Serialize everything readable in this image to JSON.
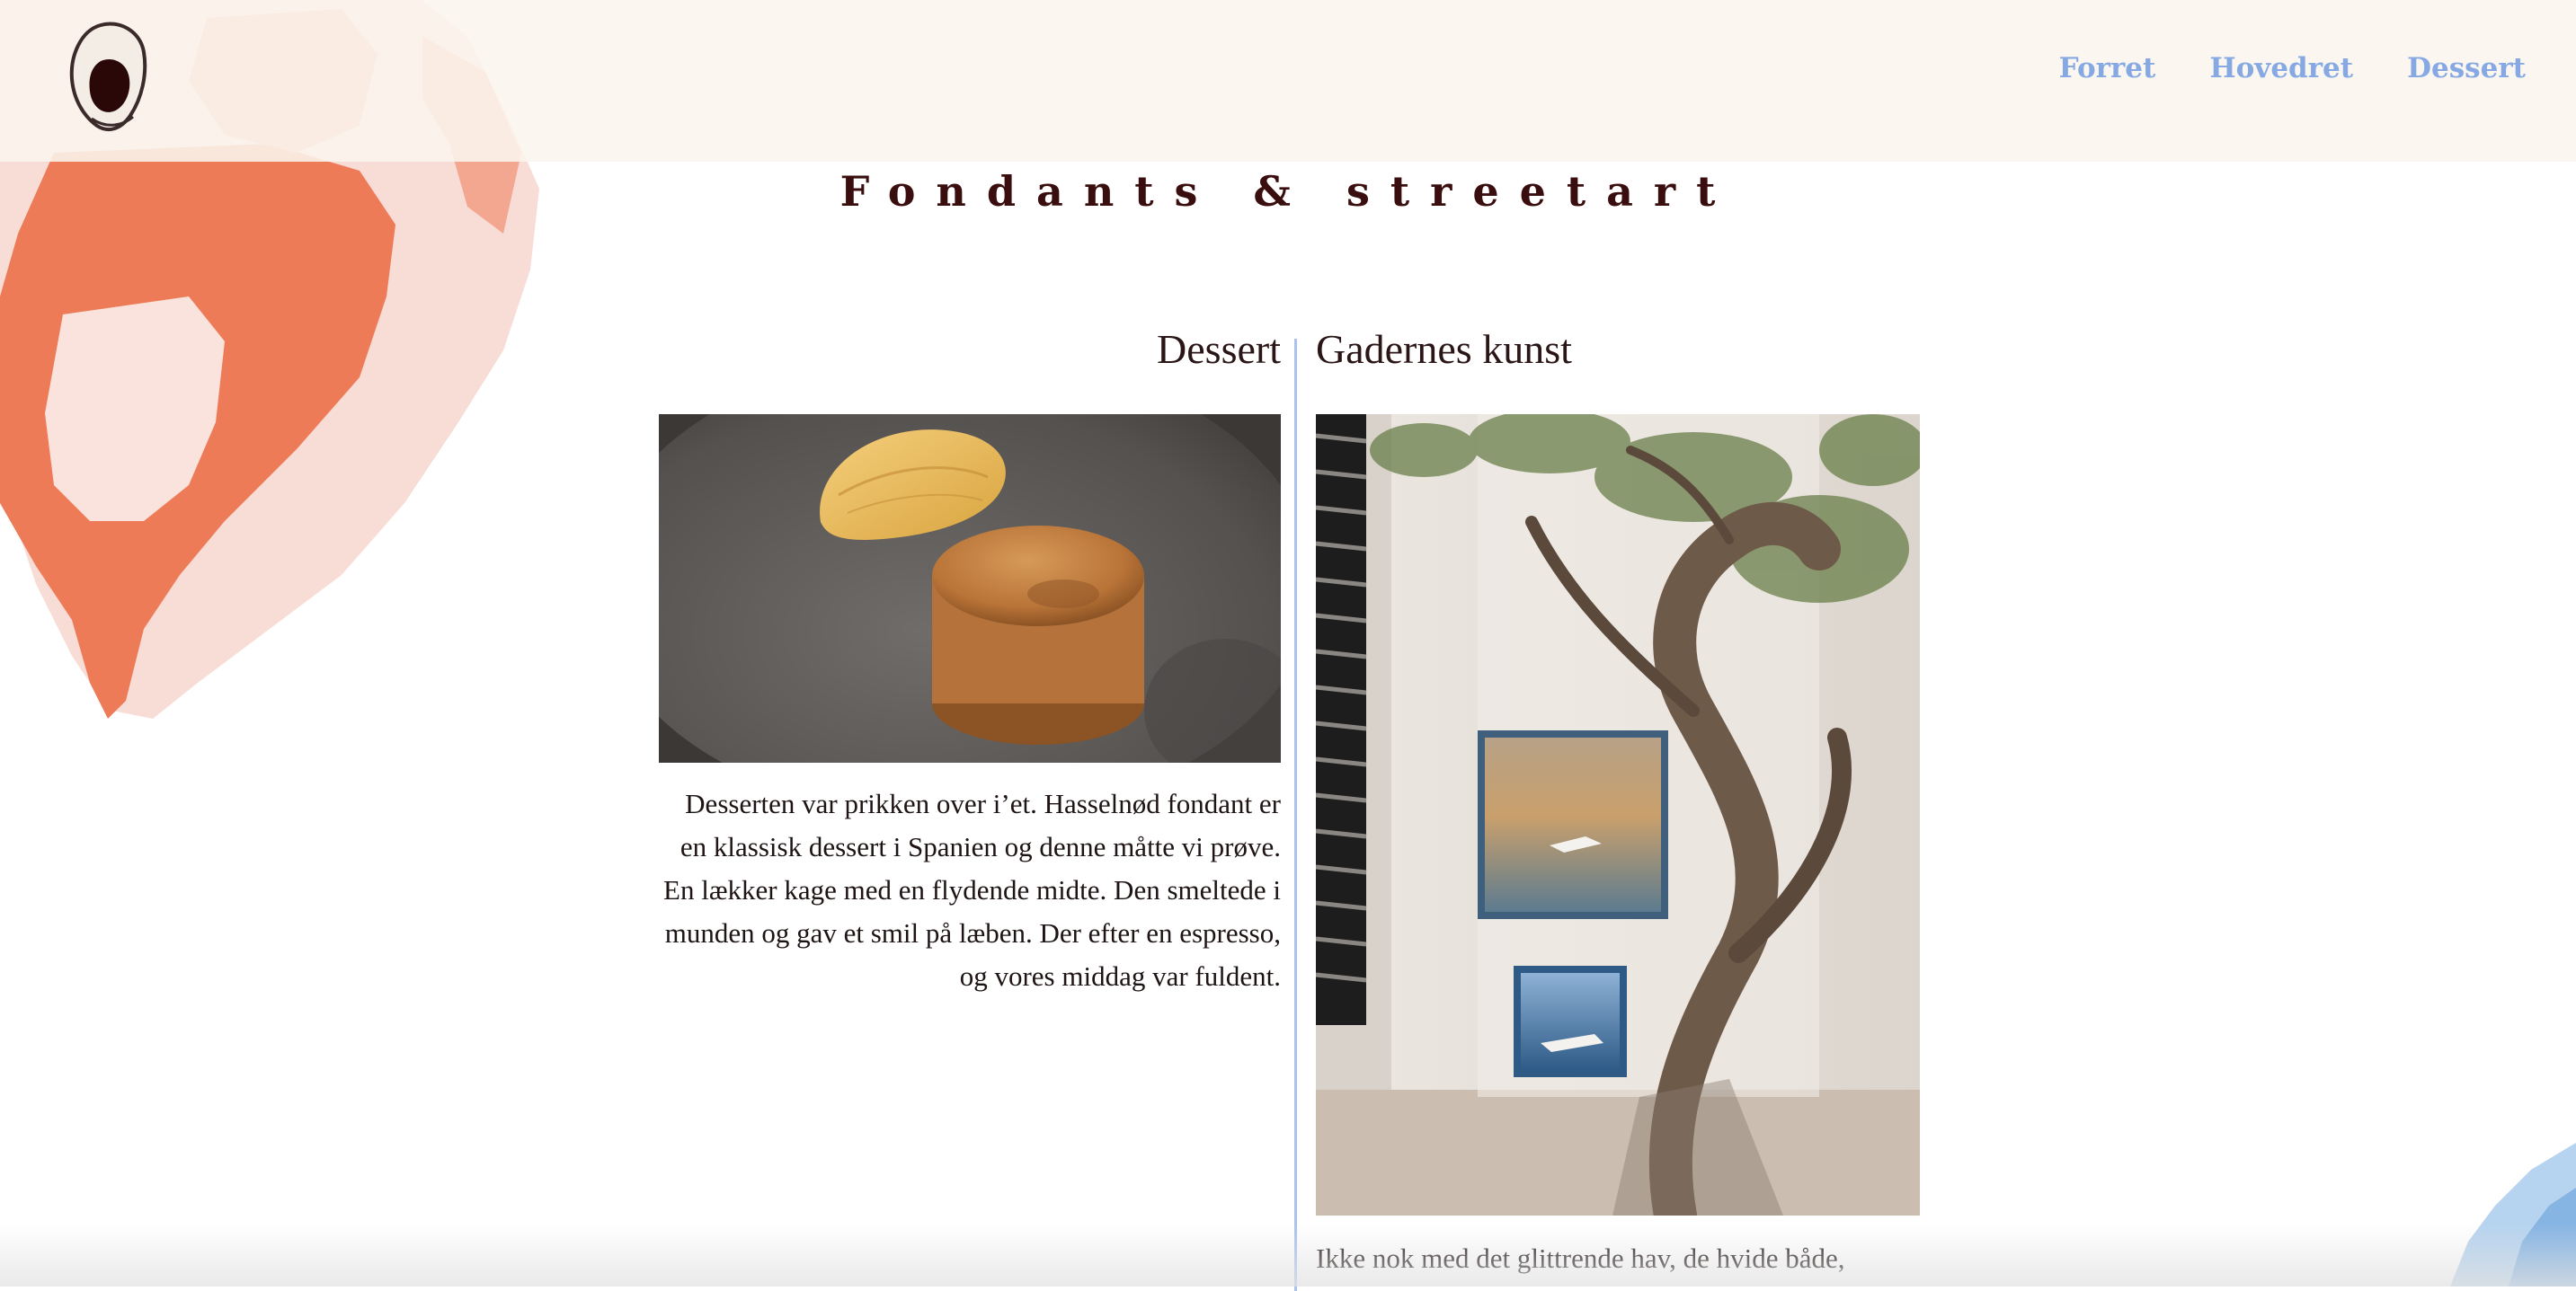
{
  "header": {
    "logo_icon": "oyster-shell-icon",
    "nav": [
      {
        "label": "Forret"
      },
      {
        "label": "Hovedret"
      },
      {
        "label": "Dessert"
      }
    ]
  },
  "page": {
    "title": "Fondants & streetart"
  },
  "sections": {
    "dessert": {
      "heading": "Dessert",
      "image": "photo-hazelnut-fondant-with-ice-cream",
      "text": "Desserten var prikken over i’et. Hasselnød fondant er en klassisk dessert i Spanien og denne måtte vi prøve. En lækker kage med en flydende midte. Den smeltede i munden og gav et smil på læben. Der efter en espresso, og vores middag var fuldent."
    },
    "street_art": {
      "heading": "Gadernes kunst",
      "image": "photo-painted-tiles-on-wall-with-olive-tree",
      "text": "Ikke nok med det glittrende hav, de hvide både,"
    }
  },
  "colors": {
    "header_bg": "#faf6ee",
    "nav_link": "#86a9e4",
    "title": "#3a0e0e",
    "divider": "#a9c3ee",
    "splash_orange": "#ee7b57",
    "splash_pink": "#f8d9d2"
  }
}
